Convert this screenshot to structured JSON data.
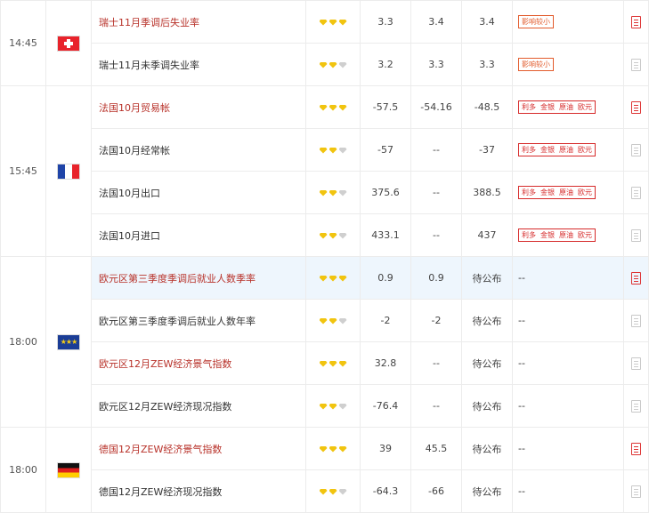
{
  "colors": {
    "highlight_text": "#b8322a",
    "star_on": "#f1c40f",
    "tag_orange": "#e25b2c",
    "tag_red": "#d62a2a",
    "selected_row": "#eef6fd"
  },
  "groups": [
    {
      "time": "14:45",
      "flag": "switzerland-flag-icon",
      "flagclass": "ch",
      "rows": [
        {
          "name": "瑞士11月季调后失业率",
          "hl": true,
          "stars": 3,
          "v1": "3.3",
          "v2": "3.4",
          "v3": "3.4",
          "impact": {
            "type": "single",
            "text": "影响较小"
          },
          "report_active": true
        },
        {
          "name": "瑞士11月未季调失业率",
          "hl": false,
          "stars": 2,
          "v1": "3.2",
          "v2": "3.3",
          "v3": "3.3",
          "impact": {
            "type": "single",
            "text": "影响较小"
          },
          "report_active": false
        }
      ]
    },
    {
      "time": "15:45",
      "flag": "france-flag-icon",
      "flagclass": "fr",
      "rows": [
        {
          "name": "法国10月贸易帐",
          "hl": true,
          "stars": 3,
          "v1": "-57.5",
          "v2": "-54.16",
          "v3": "-48.5",
          "impact": {
            "type": "multi",
            "items": [
              "利多",
              "金银",
              "原油",
              "欧元"
            ]
          },
          "report_active": true
        },
        {
          "name": "法国10月经常帐",
          "hl": false,
          "stars": 2,
          "v1": "-57",
          "v2": "--",
          "v3": "-37",
          "impact": {
            "type": "multi",
            "items": [
              "利多",
              "金银",
              "原油",
              "欧元"
            ]
          },
          "report_active": false
        },
        {
          "name": "法国10月出口",
          "hl": false,
          "stars": 2,
          "v1": "375.6",
          "v2": "--",
          "v3": "388.5",
          "impact": {
            "type": "multi",
            "items": [
              "利多",
              "金银",
              "原油",
              "欧元"
            ]
          },
          "report_active": false
        },
        {
          "name": "法国10月进口",
          "hl": false,
          "stars": 2,
          "v1": "433.1",
          "v2": "--",
          "v3": "437",
          "impact": {
            "type": "multi",
            "items": [
              "利多",
              "金银",
              "原油",
              "欧元"
            ]
          },
          "report_active": false
        }
      ]
    },
    {
      "time": "18:00",
      "flag": "eu-flag-icon",
      "flagclass": "eu",
      "rows": [
        {
          "name": "欧元区第三季度季调后就业人数季率",
          "hl": true,
          "stars": 3,
          "v1": "0.9",
          "v2": "0.9",
          "v3": "待公布",
          "impact": {
            "type": "none",
            "text": "--"
          },
          "report_active": true,
          "selected": true
        },
        {
          "name": "欧元区第三季度季调后就业人数年率",
          "hl": false,
          "stars": 2,
          "v1": "-2",
          "v2": "-2",
          "v3": "待公布",
          "impact": {
            "type": "none",
            "text": "--"
          },
          "report_active": false
        },
        {
          "name": "欧元区12月ZEW经济景气指数",
          "hl": true,
          "stars": 3,
          "v1": "32.8",
          "v2": "--",
          "v3": "待公布",
          "impact": {
            "type": "none",
            "text": "--"
          },
          "report_active": false
        },
        {
          "name": "欧元区12月ZEW经济现况指数",
          "hl": false,
          "stars": 2,
          "v1": "-76.4",
          "v2": "--",
          "v3": "待公布",
          "impact": {
            "type": "none",
            "text": "--"
          },
          "report_active": false
        }
      ]
    },
    {
      "time": "18:00",
      "flag": "germany-flag-icon",
      "flagclass": "de",
      "rows": [
        {
          "name": "德国12月ZEW经济景气指数",
          "hl": true,
          "stars": 3,
          "v1": "39",
          "v2": "45.5",
          "v3": "待公布",
          "impact": {
            "type": "none",
            "text": "--"
          },
          "report_active": true
        },
        {
          "name": "德国12月ZEW经济现况指数",
          "hl": false,
          "stars": 2,
          "v1": "-64.3",
          "v2": "-66",
          "v3": "待公布",
          "impact": {
            "type": "none",
            "text": "--"
          },
          "report_active": false
        }
      ]
    }
  ]
}
